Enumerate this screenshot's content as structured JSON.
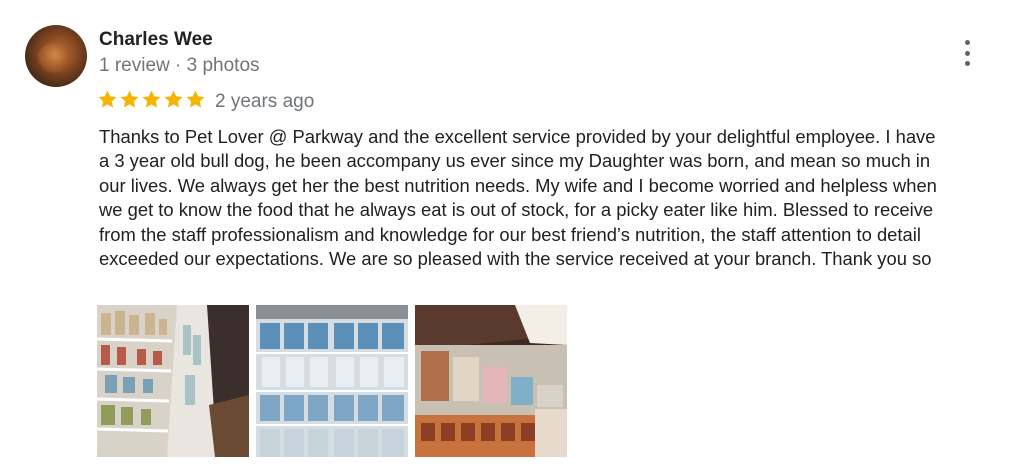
{
  "reviewer": {
    "name": "Charles Wee",
    "meta": "1 review · 3 photos"
  },
  "rating": {
    "stars": 5,
    "max": 5,
    "color": "#f4b400"
  },
  "time_ago": "2 years ago",
  "review_lines": [
    "Thanks to Pet Lover @ Parkway and the excellent service provided by your delightful employee. I have",
    "a 3 year old bull dog, he been accompany us ever since my Daughter was born, and mean so much in",
    "our lives. We always get her the best nutrition needs. My wife and I become worried and helpless when",
    "we get to know the food that he always eat is out of stock, for a picky eater like him. Blessed to receive",
    "from the staff professionalism and knowledge for our best friend’s nutrition, the staff attention to detail",
    "exceeded our expectations. We are so pleased with the service received at your branch. Thank you so"
  ],
  "menu_icon": "more-vertical-icon"
}
